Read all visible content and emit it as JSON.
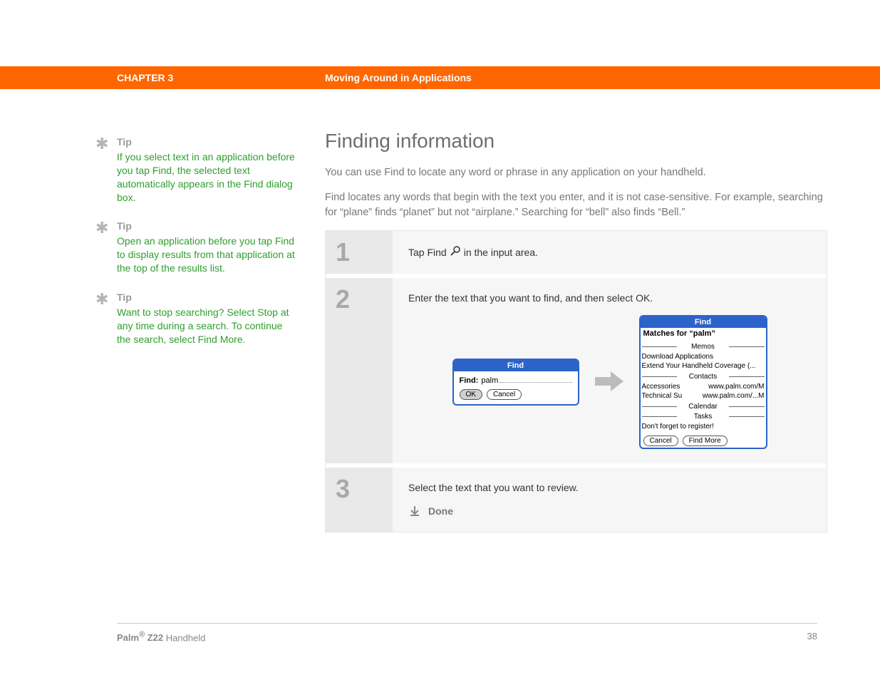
{
  "header": {
    "chapter": "CHAPTER 3",
    "title": "Moving Around in Applications"
  },
  "sidebar": {
    "tips": [
      {
        "label": "Tip",
        "body": "If you select text in an application before you tap Find, the selected text automatically appears in the Find dialog box."
      },
      {
        "label": "Tip",
        "body": "Open an application before you tap Find to display results from that application at the top of the results list."
      },
      {
        "label": "Tip",
        "body": "Want to stop searching? Select Stop at any time during a search. To continue the search, select Find More."
      }
    ]
  },
  "main": {
    "heading": "Finding information",
    "intro1": "You can use Find to locate any word or phrase in any application on your handheld.",
    "intro2": "Find locates any words that begin with the text you enter, and it is not case-sensitive. For example, searching for “plane” finds “planet” but not “airplane.” Searching for “bell” also finds “Bell.”",
    "steps": [
      {
        "num": "1",
        "text_pre": "Tap Find ",
        "text_post": " in the input area."
      },
      {
        "num": "2",
        "text": "Enter the text that you want to find, and then select OK."
      },
      {
        "num": "3",
        "text": "Select the text that you want to review.",
        "done": "Done"
      }
    ]
  },
  "dialogs": {
    "find1": {
      "title": "Find",
      "label": "Find:",
      "value": "palm",
      "ok": "OK",
      "cancel": "Cancel"
    },
    "find2": {
      "title": "Find",
      "matches": "Matches for “palm”",
      "sections": {
        "memos": {
          "label": "Memos",
          "items": [
            "Download Applications",
            "Extend Your Handheld Coverage (..."
          ]
        },
        "contacts": {
          "label": "Contacts",
          "rows": [
            {
              "l": "Accessories",
              "r": "www.palm.com/M"
            },
            {
              "l": "Technical Su",
              "r": "www.palm.com/...M"
            }
          ]
        },
        "calendar": {
          "label": "Calendar"
        },
        "tasks": {
          "label": "Tasks",
          "items": [
            "Don't forget to register!"
          ]
        }
      },
      "cancel": "Cancel",
      "more": "Find More"
    }
  },
  "footer": {
    "brand_pre": "Palm",
    "reg": "®",
    "brand_post": " Z22",
    "suffix": " Handheld",
    "page": "38"
  }
}
